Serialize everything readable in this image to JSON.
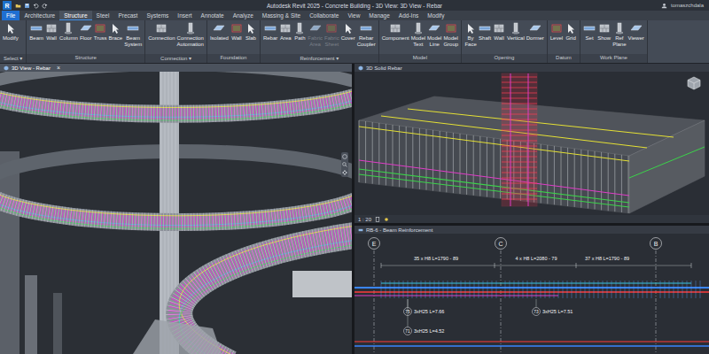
{
  "window": {
    "app_icon": "R",
    "title": "Autodesk Revit 2025 - Concrete Building - 3D View: 3D View - Rebar",
    "user": "tomaszchdala"
  },
  "menu_tabs": [
    {
      "label": "File",
      "kind": "file",
      "selected": false
    },
    {
      "label": "Architecture",
      "kind": "tab",
      "selected": false
    },
    {
      "label": "Structure",
      "kind": "tab",
      "selected": true
    },
    {
      "label": "Steel",
      "kind": "tab",
      "selected": false
    },
    {
      "label": "Precast",
      "kind": "tab",
      "selected": false
    },
    {
      "label": "Systems",
      "kind": "tab",
      "selected": false
    },
    {
      "label": "Insert",
      "kind": "tab",
      "selected": false
    },
    {
      "label": "Annotate",
      "kind": "tab",
      "selected": false
    },
    {
      "label": "Analyze",
      "kind": "tab",
      "selected": false
    },
    {
      "label": "Massing & Site",
      "kind": "tab",
      "selected": false
    },
    {
      "label": "Collaborate",
      "kind": "tab",
      "selected": false
    },
    {
      "label": "View",
      "kind": "tab",
      "selected": false
    },
    {
      "label": "Manage",
      "kind": "tab",
      "selected": false
    },
    {
      "label": "Add-Ins",
      "kind": "tab",
      "selected": false
    },
    {
      "label": "Modify",
      "kind": "tab",
      "selected": false
    }
  ],
  "ribbon": {
    "panels": [
      {
        "label": "Select ▾",
        "tools": [
          {
            "label": "Modify",
            "disabled": false
          }
        ]
      },
      {
        "label": "Structure",
        "tools": [
          {
            "label": "Beam",
            "disabled": false
          },
          {
            "label": "Wall",
            "disabled": false
          },
          {
            "label": "Column",
            "disabled": false
          },
          {
            "label": "Floor",
            "disabled": false
          },
          {
            "label": "Truss",
            "disabled": false
          },
          {
            "label": "Brace",
            "disabled": false
          },
          {
            "label": "Beam System",
            "disabled": false
          }
        ]
      },
      {
        "label": "Connection ▾",
        "tools": [
          {
            "label": "Connection",
            "disabled": false
          },
          {
            "label": "Connection Automation",
            "disabled": false
          }
        ]
      },
      {
        "label": "Foundation",
        "tools": [
          {
            "label": "Isolated",
            "disabled": false
          },
          {
            "label": "Wall",
            "disabled": false
          },
          {
            "label": "Slab",
            "disabled": false
          }
        ]
      },
      {
        "label": "Reinforcement ▾",
        "tools": [
          {
            "label": "Rebar",
            "disabled": false
          },
          {
            "label": "Area",
            "disabled": false
          },
          {
            "label": "Path",
            "disabled": false
          },
          {
            "label": "Fabric Area",
            "disabled": true
          },
          {
            "label": "Fabric Sheet",
            "disabled": true
          },
          {
            "label": "Cover",
            "disabled": false
          },
          {
            "label": "Rebar Coupler",
            "disabled": false
          }
        ]
      },
      {
        "label": "Model",
        "tools": [
          {
            "label": "Component",
            "disabled": false
          },
          {
            "label": "Model Text",
            "disabled": false
          },
          {
            "label": "Model Line",
            "disabled": false
          },
          {
            "label": "Model Group",
            "disabled": false
          }
        ]
      },
      {
        "label": "Opening",
        "tools": [
          {
            "label": "By Face",
            "disabled": false
          },
          {
            "label": "Shaft",
            "disabled": false
          },
          {
            "label": "Wall",
            "disabled": false
          },
          {
            "label": "Vertical",
            "disabled": false
          },
          {
            "label": "Dormer",
            "disabled": false
          }
        ]
      },
      {
        "label": "Datum",
        "tools": [
          {
            "label": "Level",
            "disabled": false
          },
          {
            "label": "Grid",
            "disabled": false
          }
        ]
      },
      {
        "label": "Work Plane",
        "tools": [
          {
            "label": "Set",
            "disabled": false
          },
          {
            "label": "Show",
            "disabled": false
          },
          {
            "label": "Ref Plane",
            "disabled": false
          },
          {
            "label": "Viewer",
            "disabled": false
          }
        ]
      }
    ]
  },
  "views": {
    "left": {
      "title": "3D View - Rebar",
      "close": "×",
      "selected": true
    },
    "top_right": {
      "title": "3D Solid Rebar",
      "scale": "1 : 20",
      "selected": false
    },
    "bottom_right": {
      "title": "RB-6 - Beam Reinforcement",
      "selected": false
    }
  },
  "beam_drawing": {
    "grids": [
      {
        "label": "E"
      },
      {
        "label": "C"
      },
      {
        "label": "B"
      }
    ],
    "bar_sets": [
      {
        "label": "35 x H8 L=1790 - 89"
      },
      {
        "label": "4 x H8 L=2080 - 79"
      },
      {
        "label": "37 x H8 L=1790 - 89"
      }
    ],
    "callouts": [
      {
        "mark": "75",
        "label": "3xH25 L=7.66"
      },
      {
        "mark": "73",
        "label": "3xH25 L=7.51"
      },
      {
        "mark": "71",
        "label": "3xH25 L=4.52"
      }
    ]
  }
}
